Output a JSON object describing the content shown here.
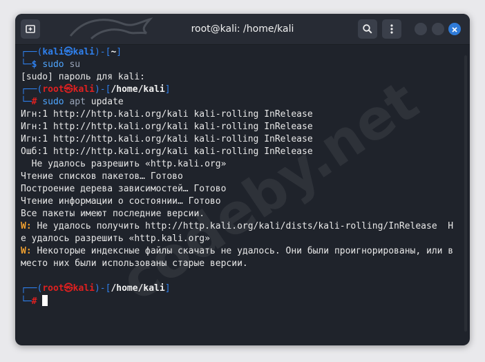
{
  "window": {
    "title": "root@kali: /home/kali"
  },
  "icons": {
    "new_tab": "new-tab-icon",
    "search": "search-icon",
    "menu": "kebab-menu-icon",
    "close": "close-icon"
  },
  "watermark": "codeby.net",
  "colors": {
    "prompt_blue": "#2f80ed",
    "root_red": "#e02020",
    "warning_orange": "#f0a030",
    "terminal_bg": "#1f232b"
  },
  "terminal": {
    "p1": {
      "top": "┌──(",
      "user": "kali",
      "sep": "㉿",
      "host": "kali",
      "dir_open": ")-[",
      "dir": "~",
      "dir_close": "]",
      "bottom": "└─",
      "sym": "$",
      "cmd": "sudo",
      "arg": "su"
    },
    "sudo_prompt": "[sudo] пароль для kali:",
    "p2": {
      "top": "┌──(",
      "user": "root",
      "sep": "㉿",
      "host": "kali",
      "dir_open": ")-[",
      "dir": "/home/kali",
      "dir_close": "]",
      "bottom": "└─",
      "sym": "#",
      "cmd": "sudo",
      "arg1": "apt",
      "arg2": "update"
    },
    "out": [
      "Игн:1 http://http.kali.org/kali kali-rolling InRelease",
      "Игн:1 http://http.kali.org/kali kali-rolling InRelease",
      "Игн:1 http://http.kali.org/kali kali-rolling InRelease",
      "Ошб:1 http://http.kali.org/kali kali-rolling InRelease",
      "  Не удалось разрешить «http.kali.org»",
      "Чтение списков пакетов… Готово",
      "Построение дерева зависимостей… Готово",
      "Чтение информации о состоянии… Готово",
      "Все пакеты имеют последние версии."
    ],
    "w1_label": "W:",
    "w1_text": " Не удалось получить http://http.kali.org/kali/dists/kali-rolling/InRelease  Н",
    "w1_cont": "е удалось разрешить «http.kali.org»",
    "w2_label": "W:",
    "w2_text": " Некоторые индексные файлы скачать не удалось. Они были проигнорированы, или в",
    "w2_cont": "место них были использованы старые версии.",
    "p3": {
      "top": "┌──(",
      "user": "root",
      "sep": "㉿",
      "host": "kali",
      "dir_open": ")-[",
      "dir": "/home/kali",
      "dir_close": "]",
      "bottom": "└─",
      "sym": "#"
    }
  }
}
